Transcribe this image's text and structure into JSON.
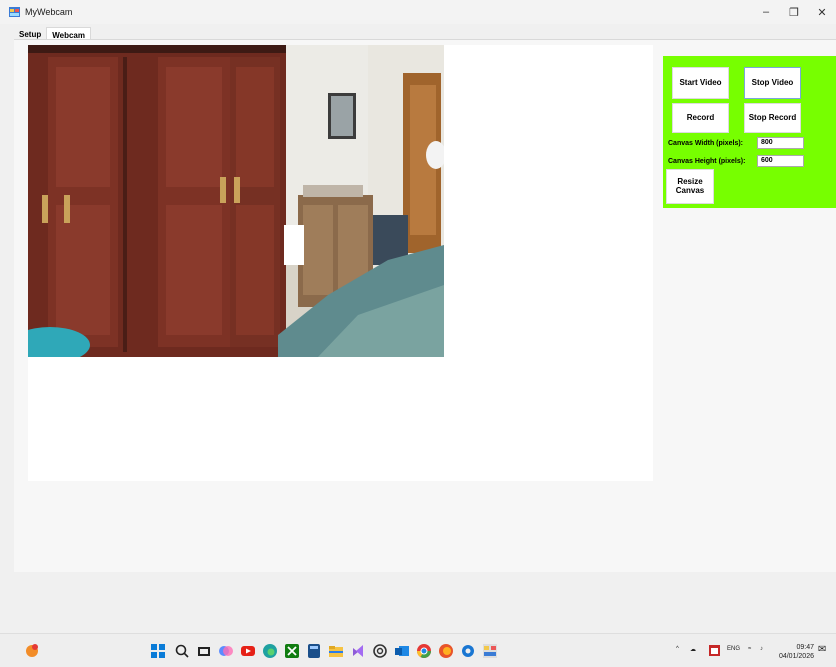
{
  "window": {
    "title": "MyWebcam"
  },
  "tabs": [
    {
      "label": "Setup",
      "active": false
    },
    {
      "label": "Webcam",
      "active": true
    }
  ],
  "controls": {
    "start_video": "Start Video",
    "stop_video": "Stop Video",
    "record": "Record",
    "stop_record": "Stop Record",
    "canvas_width_label": "Canvas Width (pixels):",
    "canvas_width_value": "800",
    "canvas_height_label": "Canvas Height (pixels):",
    "canvas_height_value": "600",
    "resize_canvas": "Resize\nCanvas"
  },
  "colors": {
    "panel": "#77ff00",
    "canvas": "#ffffff"
  },
  "taskbar": {
    "language": "ENG",
    "time": "09:47",
    "date": "04/01/2026",
    "icons": [
      "start-icon",
      "search-icon",
      "task-view-icon",
      "copilot-icon",
      "youtube-icon",
      "edge-icon",
      "xbox-icon",
      "calculator-icon",
      "file-explorer-icon",
      "visual-studio-icon",
      "chatgpt-icon",
      "outlook-icon",
      "chrome-icon",
      "firefox-icon",
      "settings-icon",
      "mywebcam-app-icon"
    ]
  }
}
